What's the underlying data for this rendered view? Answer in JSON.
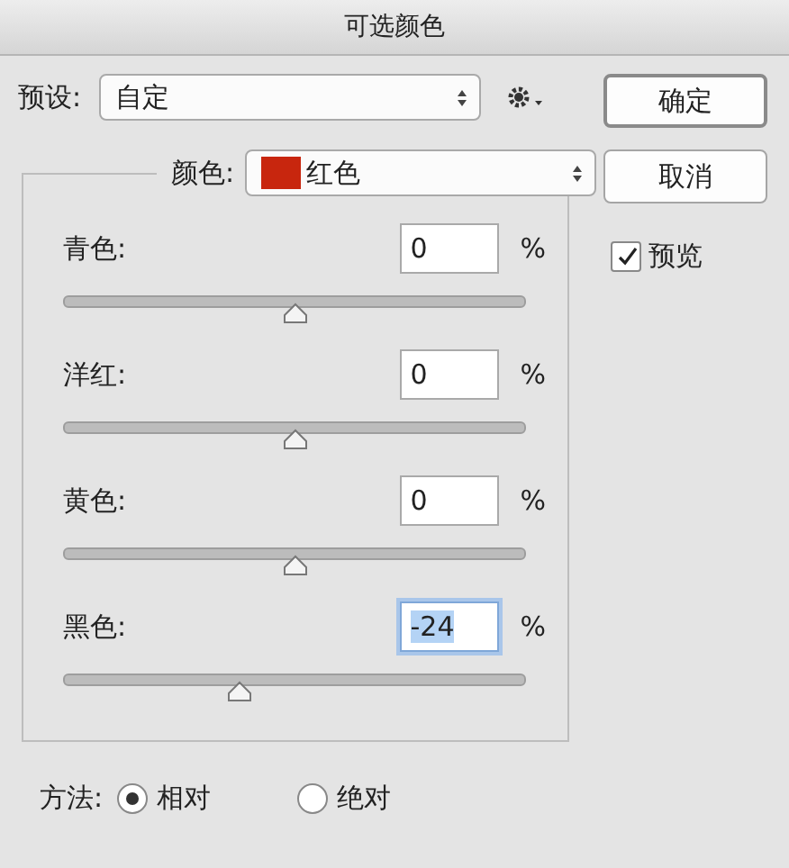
{
  "window": {
    "title": "可选颜色"
  },
  "preset": {
    "label": "预设:",
    "value": "自定"
  },
  "buttons": [
    {
      "label": "确定",
      "default": true
    },
    {
      "label": "取消",
      "default": false
    }
  ],
  "preview": {
    "label": "预览",
    "checked": true
  },
  "colors": {
    "label": "颜色:",
    "value": "红色",
    "color": "#c8260e"
  },
  "channels": [
    {
      "name": "青色:",
      "value": "0",
      "unit": "%",
      "level": 0.5,
      "highlighted": false
    },
    {
      "name": "洋红:",
      "value": "0",
      "unit": "%",
      "level": 0.5,
      "highlighted": false
    },
    {
      "name": "黄色:",
      "value": "0",
      "unit": "%",
      "level": 0.5,
      "highlighted": false
    },
    {
      "name": "黑色:",
      "value": "-24",
      "unit": "%",
      "level": 0.38,
      "highlighted": true
    }
  ],
  "method": {
    "label": "方法:",
    "options": [
      {
        "label": "相对",
        "selected": true
      },
      {
        "label": "绝对",
        "selected": false
      }
    ]
  }
}
